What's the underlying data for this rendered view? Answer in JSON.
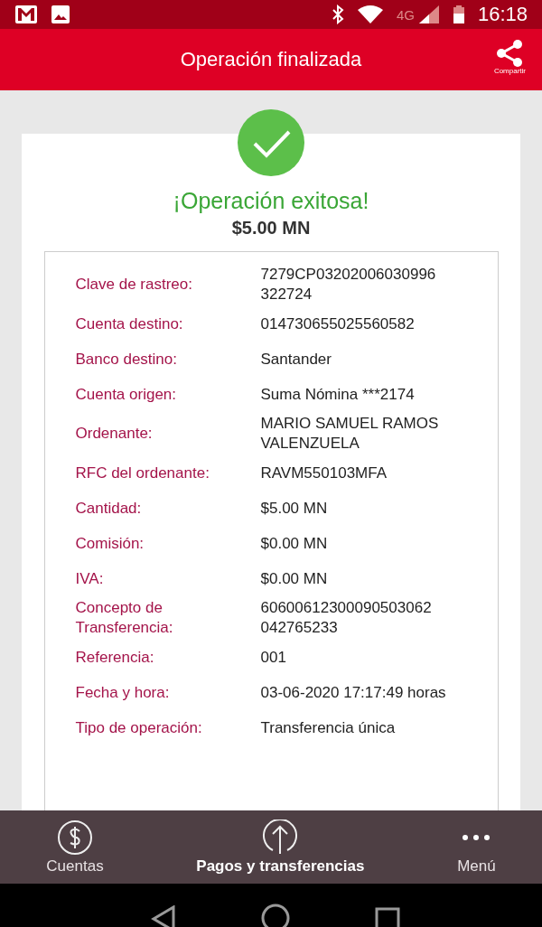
{
  "status_bar": {
    "time": "16:18",
    "network": "4G"
  },
  "header": {
    "title": "Operación finalizada",
    "share_label": "Compartir"
  },
  "result": {
    "title": "¡Operación exitosa!",
    "amount": "$5.00 MN"
  },
  "details": [
    {
      "label": "Clave de rastreo:",
      "value": "7279CP03202006030996\n322724"
    },
    {
      "label": "Cuenta destino:",
      "value": "014730655025560582"
    },
    {
      "label": "Banco destino:",
      "value": "Santander"
    },
    {
      "label": "Cuenta origen:",
      "value": "Suma Nómina  ***2174"
    },
    {
      "label": "Ordenante:",
      "value": "MARIO SAMUEL RAMOS\nVALENZUELA"
    },
    {
      "label": "RFC del ordenante:",
      "value": "RAVM550103MFA"
    },
    {
      "label": "Cantidad:",
      "value": "$5.00 MN"
    },
    {
      "label": "Comisión:",
      "value": "$0.00 MN"
    },
    {
      "label": "IVA:",
      "value": "$0.00 MN"
    },
    {
      "label": "Concepto de\nTransferencia:",
      "value": "60600612300090503062\n042765233"
    },
    {
      "label": "Referencia:",
      "value": "001"
    },
    {
      "label": "Fecha y hora:",
      "value": " 03-06-2020 17:17:49 horas"
    },
    {
      "label": "Tipo de operación:",
      "value": "Transferencia única"
    }
  ],
  "bottom_nav": [
    {
      "kind": "dollar",
      "label": "Cuentas",
      "selected": false
    },
    {
      "kind": "arrow",
      "label": "Pagos y transferencias",
      "selected": true
    },
    {
      "kind": "dots",
      "label": "Menú",
      "selected": false
    }
  ]
}
